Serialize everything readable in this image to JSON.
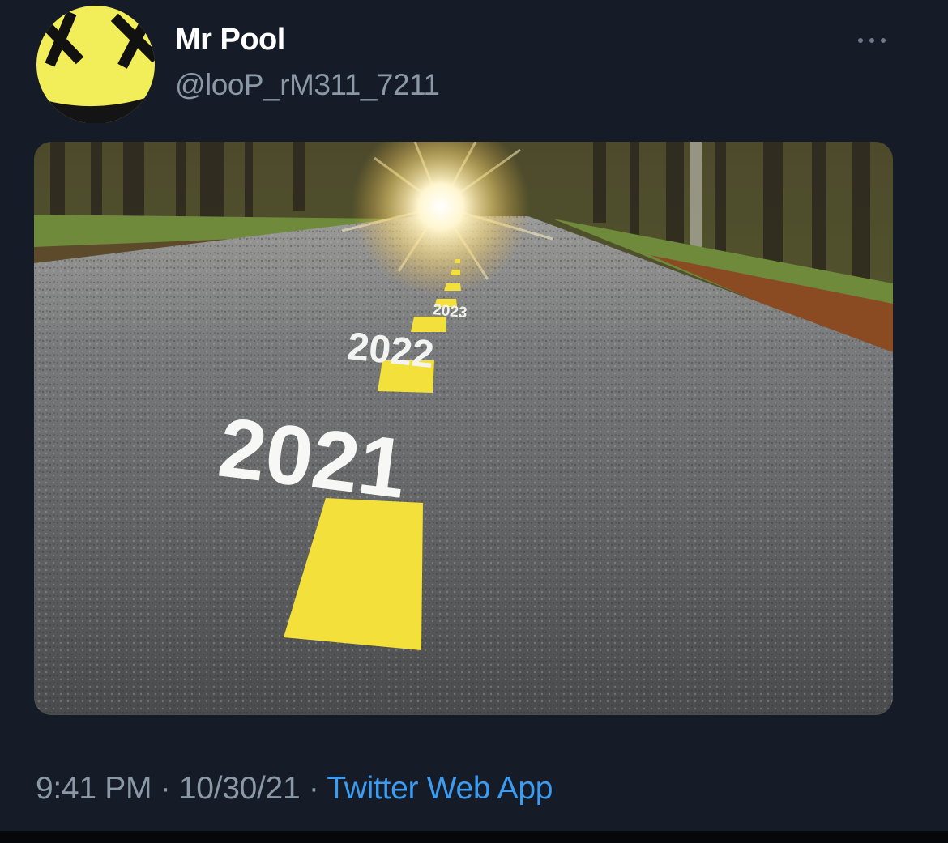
{
  "user": {
    "display_name": "Mr Pool",
    "handle": "@looP_rM311_7211",
    "avatar_icon": "smiley-face-icon",
    "avatar_color": "#f2ee5a"
  },
  "actions": {
    "more_icon": "more-dots-icon"
  },
  "media": {
    "road_markings": [
      "2021",
      "2022",
      "2023"
    ]
  },
  "meta": {
    "time": "9:41 PM",
    "separator": " · ",
    "date": "10/30/21",
    "source": "Twitter Web App"
  },
  "colors": {
    "background": "#151c28",
    "name": "#ffffff",
    "secondary_text": "#8b98a5",
    "link": "#3d9cf0",
    "lane_marking": "#f3e03a"
  }
}
